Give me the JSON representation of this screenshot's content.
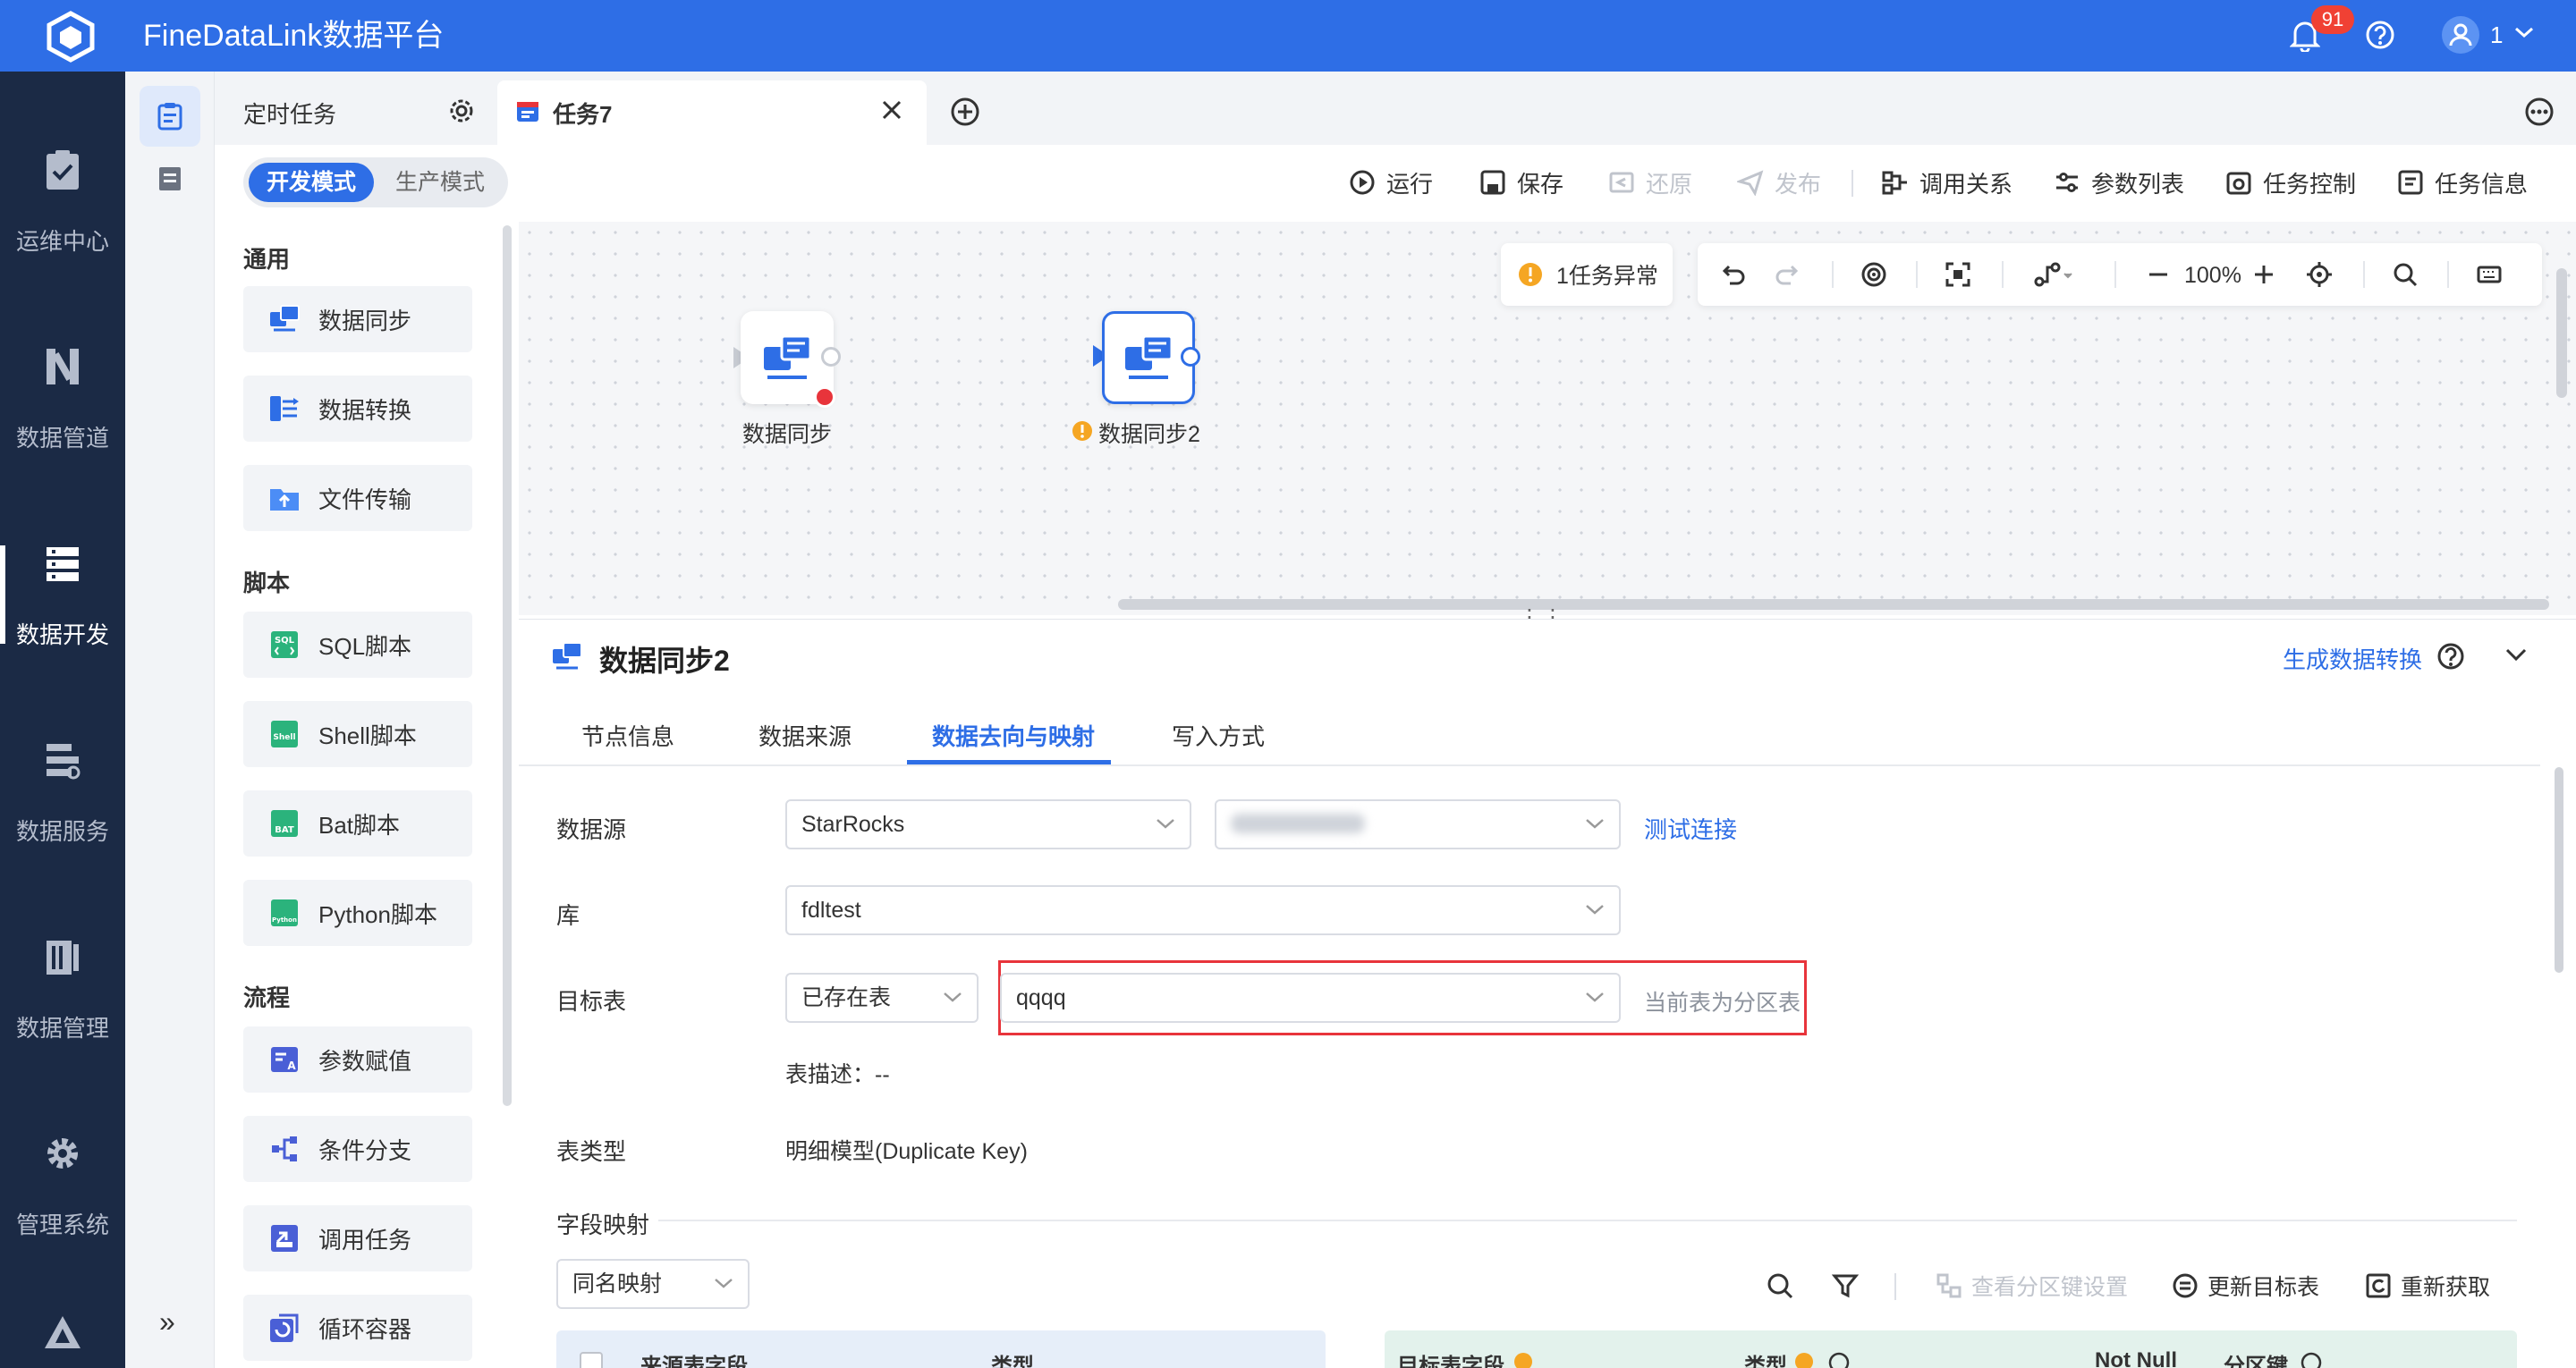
{
  "app": {
    "title": "FineDataLink数据平台",
    "notification_count": "91",
    "user_name": "1"
  },
  "leftnav": [
    {
      "label": "运维中心",
      "icon": "clipboard-check-icon",
      "active": false
    },
    {
      "label": "数据管道",
      "icon": "pipeline-icon",
      "active": false
    },
    {
      "label": "数据开发",
      "icon": "server-stack-icon",
      "active": true
    },
    {
      "label": "数据服务",
      "icon": "data-service-icon",
      "active": false
    },
    {
      "label": "数据管理",
      "icon": "data-management-icon",
      "active": false
    },
    {
      "label": "管理系统",
      "icon": "gear-icon",
      "active": false
    }
  ],
  "tabs": [
    {
      "label": "定时任务"
    },
    {
      "label": "任务7"
    }
  ],
  "mode": {
    "dev": "开发模式",
    "prod": "生产模式"
  },
  "toolbar": {
    "run": "运行",
    "save": "保存",
    "restore": "还原",
    "publish": "发布",
    "call_relation": "调用关系",
    "param_list": "参数列表",
    "task_control": "任务控制",
    "task_info": "任务信息"
  },
  "palette": {
    "groups": [
      {
        "title": "通用",
        "items": [
          "数据同步",
          "数据转换",
          "文件传输"
        ]
      },
      {
        "title": "脚本",
        "items": [
          "SQL脚本",
          "Shell脚本",
          "Bat脚本",
          "Python脚本"
        ]
      },
      {
        "title": "流程",
        "items": [
          "参数赋值",
          "条件分支",
          "调用任务",
          "循环容器"
        ]
      }
    ]
  },
  "canvas": {
    "alert": "1任务异常",
    "zoom": "100%",
    "nodes": [
      {
        "label": "数据同步",
        "status": "error"
      },
      {
        "label": "数据同步2",
        "status": "warning"
      }
    ]
  },
  "detail": {
    "title": "数据同步2",
    "generate_transform": "生成数据转换",
    "tabs": [
      "节点信息",
      "数据来源",
      "数据去向与映射",
      "写入方式"
    ],
    "active_tab": "数据去向与映射",
    "form": {
      "datasource_label": "数据源",
      "datasource_value": "StarRocks",
      "test_connection": "测试连接",
      "db_label": "库",
      "db_value": "fdltest",
      "target_label": "目标表",
      "target_mode": "已存在表",
      "target_table": "qqqq",
      "partition_note": "当前表为分区表",
      "table_desc": "表描述：--",
      "table_type_label": "表类型",
      "table_type_value": "明细模型(Duplicate Key)"
    },
    "field_mapping": {
      "label": "字段映射",
      "mode": "同名映射",
      "view_partition": "查看分区键设置",
      "refresh_target": "更新目标表",
      "refetch": "重新获取",
      "source_columns": [
        "来源表字段",
        "类型"
      ],
      "target_columns": [
        "目标表字段",
        "类型",
        "Not Null",
        "分区键"
      ]
    }
  },
  "colors": {
    "primary": "#2e6ee6",
    "nav_bg": "#1b2a45",
    "error": "#e8343b",
    "warning": "#f5a623"
  }
}
